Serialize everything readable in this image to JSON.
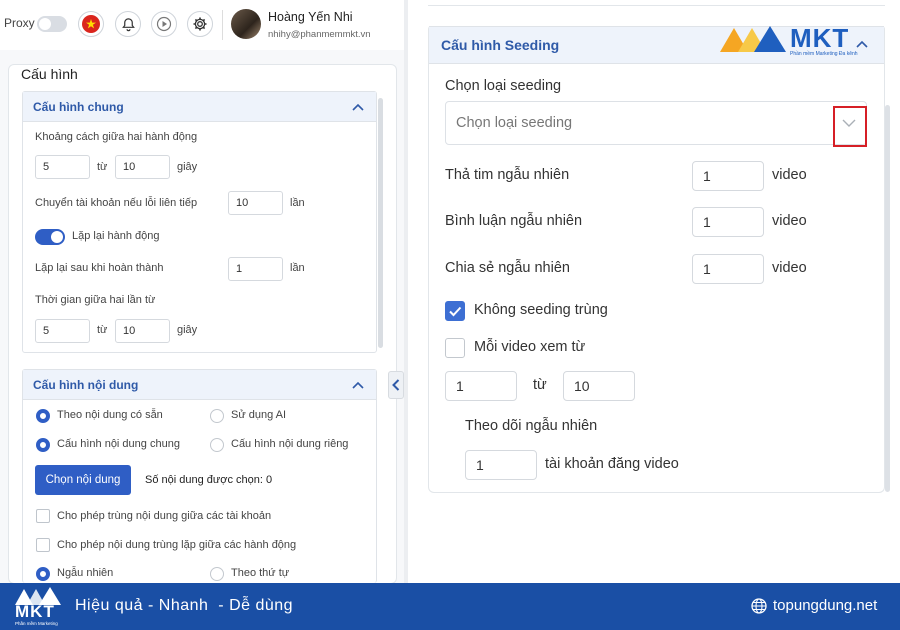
{
  "topbar": {
    "proxy_label": "Proxy",
    "user_name": "Hoàng Yến Nhi",
    "user_email": "nhihy@phanmemmkt.vn",
    "icons": [
      "vietnam-flag-icon",
      "bell-icon",
      "play-icon",
      "gear-icon"
    ]
  },
  "left": {
    "title": "Cấu hình",
    "general": {
      "header": "Cấu hình chung",
      "interval_label": "Khoảng cách giữa hai hành động",
      "interval_from": "5",
      "interval_to_word": "từ",
      "interval_to": "10",
      "interval_unit": "giây",
      "switch_label": "Chuyển tài khoản nếu lỗi liên tiếp",
      "switch_value": "10",
      "switch_unit": "lần",
      "repeat_toggle_label": "Lặp lại hành động",
      "repeat_after_label": "Lặp lại sau khi hoàn thành",
      "repeat_after_value": "1",
      "repeat_after_unit": "lần",
      "between_label": "Thời gian giữa hai lần từ",
      "between_from": "5",
      "between_word": "từ",
      "between_to": "10",
      "between_unit": "giây"
    },
    "content": {
      "header": "Cấu hình nội dung",
      "radio_available": "Theo nội dung có sẵn",
      "radio_ai": "Sử dụng AI",
      "radio_common": "Cấu hình nội dung chung",
      "radio_separate": "Cấu hình nội dung riêng",
      "choose_button": "Chọn nội dung",
      "selected_count": "Số nội dung được chọn: 0",
      "allow_dup_accounts": "Cho phép trùng nội dung giữa các tài khoản",
      "allow_dup_actions": "Cho phép nội dung trùng lặp giữa các hành động",
      "radio_random": "Ngẫu nhiên",
      "radio_order": "Theo thứ tự"
    }
  },
  "right": {
    "header": "Cấu hình Seeding",
    "seeding_type_label": "Chọn loại seeding",
    "seeding_type_placeholder": "Chọn loại seeding",
    "heart_label": "Thả tim ngẫu nhiên",
    "heart_value": "1",
    "heart_unit": "video",
    "comment_label": "Bình luận ngẫu nhiên",
    "comment_value": "1",
    "comment_unit": "video",
    "share_label": "Chia sẻ ngẫu nhiên",
    "share_value": "1",
    "share_unit": "video",
    "no_dup_label": "Không seeding trùng",
    "no_dup_checked": true,
    "each_video_label": "Mỗi video xem từ",
    "each_video_checked": false,
    "watch_from": "1",
    "watch_word": "từ",
    "watch_to": "10",
    "follow_label": "Theo dõi ngẫu nhiên",
    "follow_value": "1",
    "follow_unit": "tài khoản đăng video",
    "logo_text": "MKT",
    "logo_tagline": "Phần mềm Marketing Đa kênh"
  },
  "footer": {
    "logo_text": "MKT",
    "logo_tagline": "Phần mềm Marketing",
    "slogan": "Hiệu quả - Nhanh  - Dễ dùng",
    "site": "topungdung.net"
  },
  "colors": {
    "accent": "#2f5ec5",
    "footer": "#1a4fa5",
    "highlight": "#d61f26"
  }
}
